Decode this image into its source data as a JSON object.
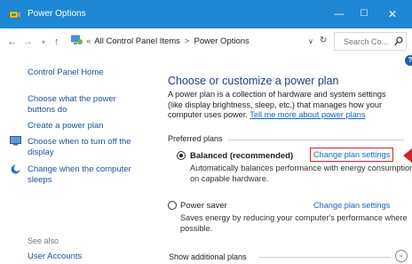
{
  "window": {
    "title": "Power Options",
    "minimize": "—",
    "maximize": "☐",
    "close": "✕"
  },
  "address": {
    "back": "←",
    "forward": "→",
    "recent": "▾",
    "up": "↑",
    "lead": "«",
    "crumbs": [
      "All Control Panel Items",
      "Power Options"
    ],
    "separator": ">",
    "dropdown": "∨",
    "refresh": "↻",
    "search_placeholder": "Search Co..."
  },
  "help": "?",
  "sidebar": {
    "home": "Control Panel Home",
    "links": [
      "Choose what the power buttons do",
      "Create a power plan",
      "Choose when to turn off the display",
      "Change when the computer sleeps"
    ],
    "see_also": "See also",
    "user_accounts": "User Accounts"
  },
  "main": {
    "title": "Choose or customize a power plan",
    "description": "A power plan is a collection of hardware and system settings (like display brightness, sleep, etc.) that manages how your computer uses power.",
    "tell_me": "Tell me more about power plans",
    "preferred_plans": "Preferred plans",
    "plans": [
      {
        "name": "Balanced (recommended)",
        "selected": true,
        "link": "Change plan settings",
        "description": "Automatically balances performance with energy consumption on capable hardware."
      },
      {
        "name": "Power saver",
        "selected": false,
        "link": "Change plan settings",
        "description": "Saves energy by reducing your computer's performance where possible."
      }
    ],
    "show_additional": "Show additional plans",
    "expand_icon": "⌄"
  },
  "colors": {
    "titlebar": "#1e88d7",
    "link": "#1565c0",
    "highlight": "#d4232a",
    "heading": "#1e3d80"
  }
}
